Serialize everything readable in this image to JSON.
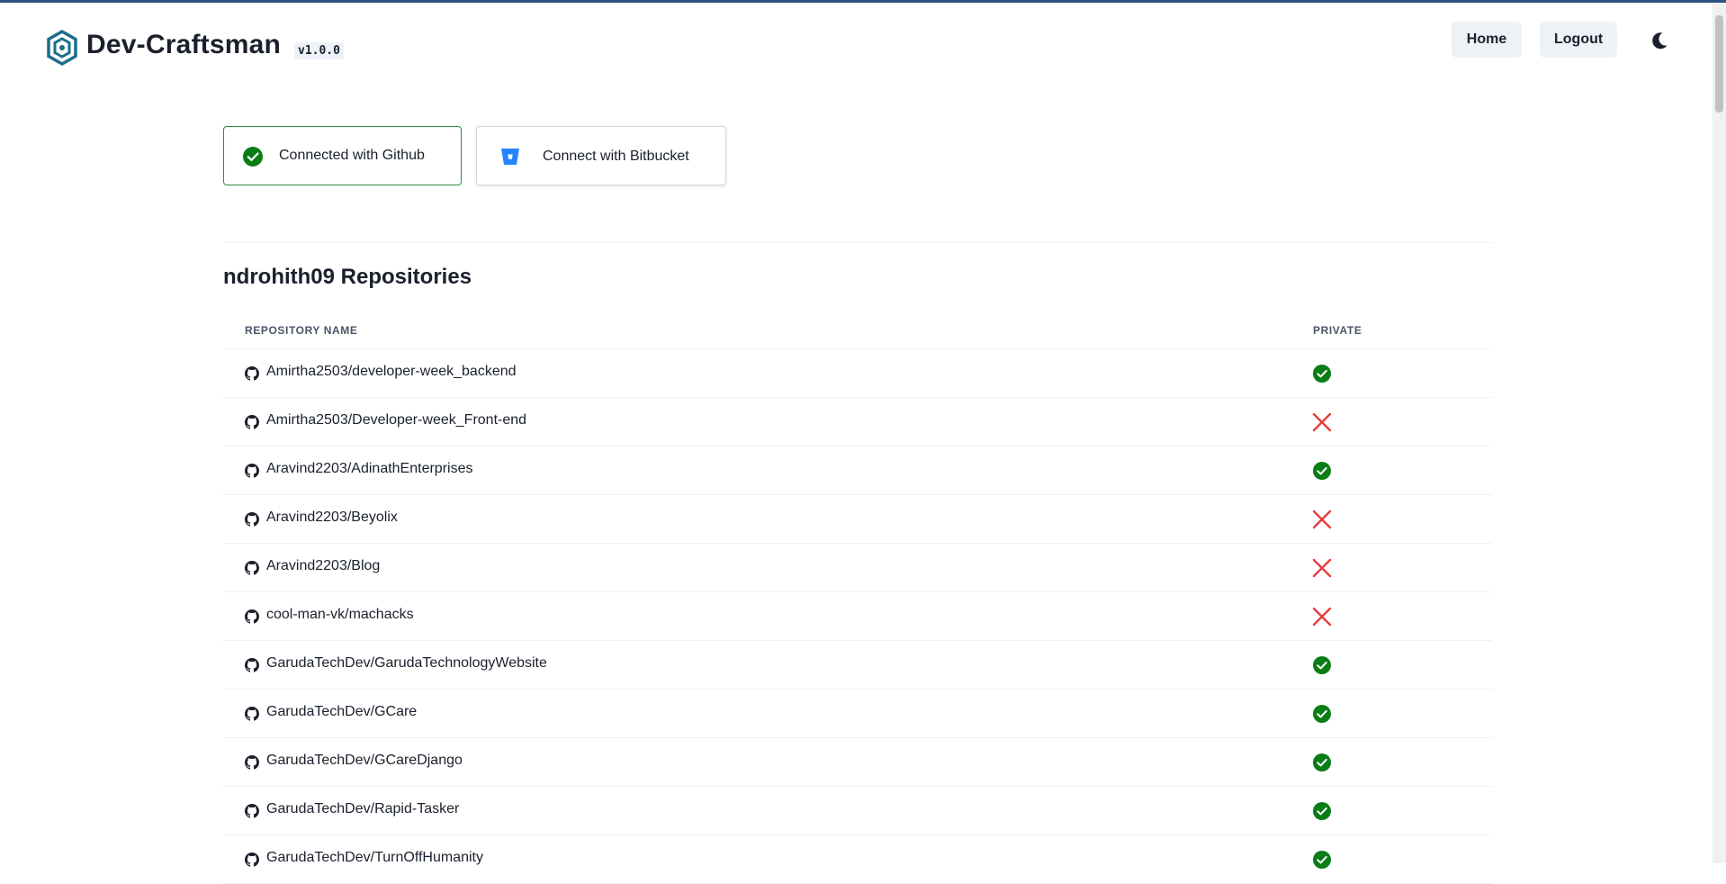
{
  "app": {
    "name": "Dev-Craftsman",
    "version": "v1.0.0"
  },
  "nav": {
    "home_label": "Home",
    "logout_label": "Logout"
  },
  "icons": {
    "logo": "hexagon-logo-icon",
    "theme": "moon-icon",
    "github": "github-icon",
    "bitbucket": "bitbucket-icon",
    "connected": "check-circle-icon",
    "private_true": "check-circle-icon",
    "private_false": "x-icon"
  },
  "colors": {
    "accent": "#2c5282",
    "success": "#0a7d17",
    "danger": "#e53e3e",
    "bitbucket": "#2684ff",
    "logo": "#1d6e8c"
  },
  "connections": {
    "github_label": "Connected with Github",
    "bitbucket_label": "Connect with Bitbucket"
  },
  "repositories": {
    "title": "ndrohith09 Repositories",
    "columns": {
      "name": "Repository Name",
      "private": "Private"
    },
    "items": [
      {
        "name": "Amirtha2503/developer-week_backend",
        "private": true
      },
      {
        "name": "Amirtha2503/Developer-week_Front-end",
        "private": false
      },
      {
        "name": "Aravind2203/AdinathEnterprises",
        "private": true
      },
      {
        "name": "Aravind2203/Beyolix",
        "private": false
      },
      {
        "name": "Aravind2203/Blog",
        "private": false
      },
      {
        "name": "cool-man-vk/machacks",
        "private": false
      },
      {
        "name": "GarudaTechDev/GarudaTechnologyWebsite",
        "private": true
      },
      {
        "name": "GarudaTechDev/GCare",
        "private": true
      },
      {
        "name": "GarudaTechDev/GCareDjango",
        "private": true
      },
      {
        "name": "GarudaTechDev/Rapid-Tasker",
        "private": true
      },
      {
        "name": "GarudaTechDev/TurnOffHumanity",
        "private": true
      }
    ]
  }
}
